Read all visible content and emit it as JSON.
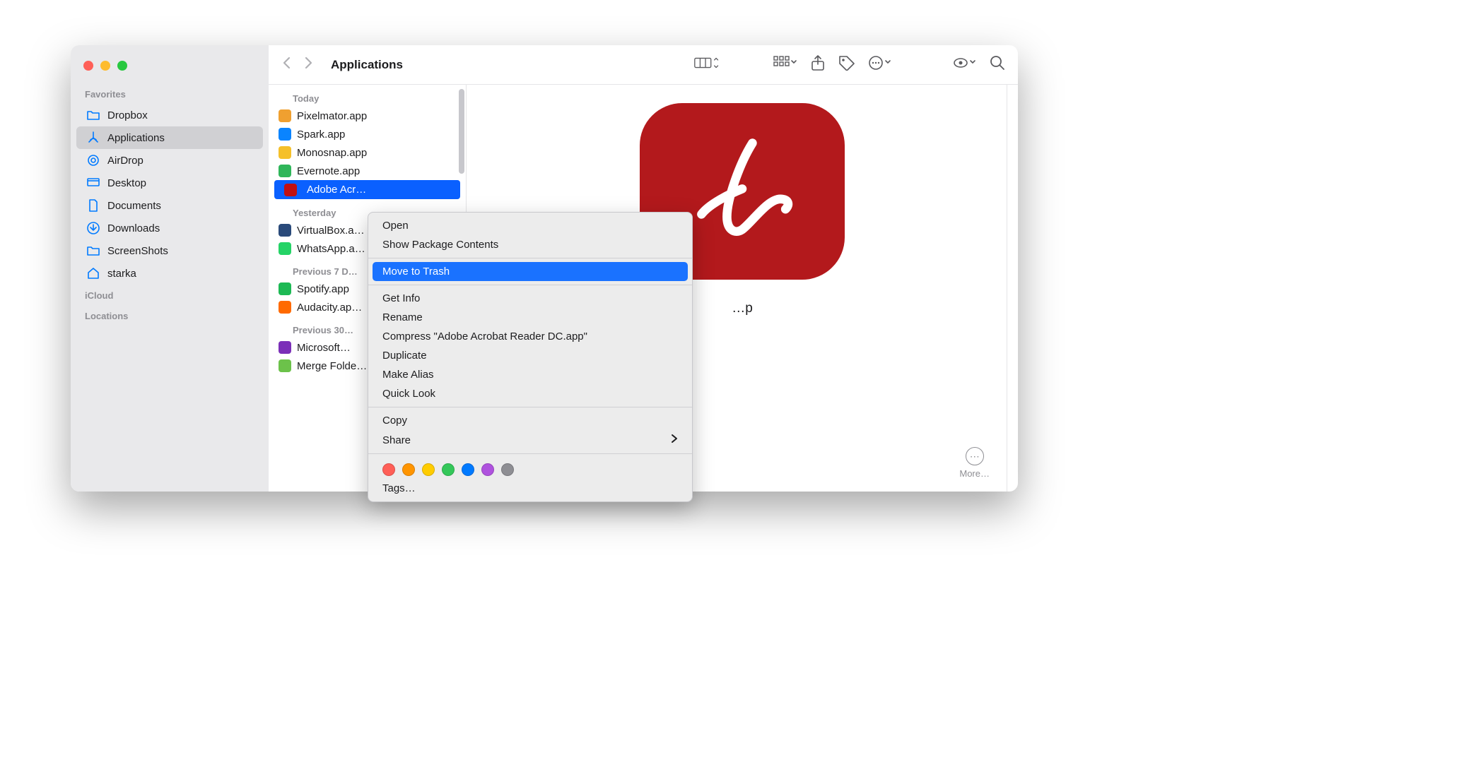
{
  "window": {
    "title": "Applications"
  },
  "sidebar": {
    "sections": [
      {
        "label": "Favorites",
        "items": [
          {
            "icon": "folder",
            "label": "Dropbox"
          },
          {
            "icon": "apps",
            "label": "Applications",
            "active": true
          },
          {
            "icon": "airdrop",
            "label": "AirDrop"
          },
          {
            "icon": "desktop",
            "label": "Desktop"
          },
          {
            "icon": "document",
            "label": "Documents"
          },
          {
            "icon": "download",
            "label": "Downloads"
          },
          {
            "icon": "folder",
            "label": "ScreenShots"
          },
          {
            "icon": "home",
            "label": "starka"
          }
        ]
      },
      {
        "label": "iCloud",
        "items": []
      },
      {
        "label": "Locations",
        "items": []
      }
    ]
  },
  "file_list": {
    "groups": [
      {
        "label": "Today",
        "items": [
          {
            "icon_bg": "#f0a030",
            "name": "Pixelmator.app"
          },
          {
            "icon_bg": "#0a84ff",
            "name": "Spark.app"
          },
          {
            "icon_bg": "#f5c02a",
            "name": "Monosnap.app"
          },
          {
            "icon_bg": "#2fb65a",
            "name": "Evernote.app"
          },
          {
            "icon_bg": "#c00f12",
            "name": "Adobe Acr…",
            "selected": true
          }
        ]
      },
      {
        "label": "Yesterday",
        "items": [
          {
            "icon_bg": "#2a4a7a",
            "name": "VirtualBox.a…"
          },
          {
            "icon_bg": "#25d366",
            "name": "WhatsApp.a…"
          }
        ]
      },
      {
        "label": "Previous 7 D…",
        "items": [
          {
            "icon_bg": "#1db954",
            "name": "Spotify.app"
          },
          {
            "icon_bg": "#ff6a00",
            "name": "Audacity.ap…"
          }
        ]
      },
      {
        "label": "Previous 30…",
        "items": [
          {
            "icon_bg": "#7b2fb8",
            "name": "Microsoft…"
          },
          {
            "icon_bg": "#6cc24a",
            "name": "Merge Folde…"
          }
        ]
      }
    ]
  },
  "preview": {
    "name": "…p",
    "more_label": "More…"
  },
  "context_menu": {
    "items": [
      {
        "label": "Open"
      },
      {
        "label": "Show Package Contents"
      },
      {
        "sep": true
      },
      {
        "label": "Move to Trash",
        "highlight": true
      },
      {
        "sep": true
      },
      {
        "label": "Get Info"
      },
      {
        "label": "Rename"
      },
      {
        "label": "Compress \"Adobe Acrobat Reader DC.app\""
      },
      {
        "label": "Duplicate"
      },
      {
        "label": "Make Alias"
      },
      {
        "label": "Quick Look"
      },
      {
        "sep": true
      },
      {
        "label": "Copy"
      },
      {
        "label": "Share",
        "submenu": true
      },
      {
        "sep": true
      },
      {
        "tags": [
          "#ff5f57",
          "#ff9500",
          "#ffcc00",
          "#34c759",
          "#007aff",
          "#af52de",
          "#8e8e93"
        ]
      },
      {
        "label": "Tags…"
      }
    ]
  }
}
